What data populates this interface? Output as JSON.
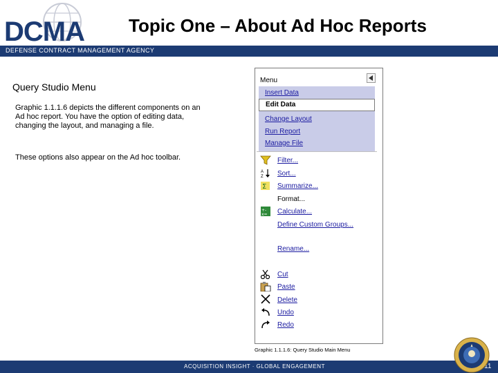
{
  "header": {
    "logo_text": "DCMA",
    "title": "Topic One – About Ad Hoc Reports",
    "agency": "DEFENSE CONTRACT MANAGEMENT AGENCY",
    "brand_color": "#1c3b73"
  },
  "content": {
    "subheading": "Query Studio Menu",
    "description": "Graphic 1.1.1.6 depicts the different components on an Ad hoc report. You have the option of editing data, changing the layout, and managing a file.",
    "note": "These options also appear on the Ad hoc toolbar."
  },
  "menu": {
    "header_label": "Menu",
    "collapse_icon": "triangle-left-icon",
    "main_items": [
      {
        "label": "Insert Data"
      },
      {
        "label": "Edit Data",
        "selected": true
      },
      {
        "label": "Change Layout"
      },
      {
        "label": "Run Report"
      },
      {
        "label": "Manage File"
      }
    ],
    "sub_items": [
      {
        "label": "Filter...",
        "icon": "filter-funnel-icon"
      },
      {
        "label": "Sort...",
        "icon": "sort-az-icon"
      },
      {
        "label": "Summarize...",
        "icon": "summarize-sigma-icon"
      },
      {
        "label": "Format..."
      },
      {
        "label": "Calculate...",
        "icon": "calculator-icon"
      },
      {
        "label": "Define Custom Groups..."
      },
      {
        "label": "Rename..."
      },
      {
        "label": "Cut",
        "icon": "scissors-icon"
      },
      {
        "label": "Paste",
        "icon": "clipboard-icon"
      },
      {
        "label": "Delete",
        "icon": "delete-x-icon"
      },
      {
        "label": "Undo",
        "icon": "undo-arrow-icon"
      },
      {
        "label": "Redo",
        "icon": "redo-arrow-icon"
      }
    ],
    "caption": "Graphic  1.1.1.6: Query Studio Main Menu"
  },
  "footer": {
    "tagline": "ACQUISITION INSIGHT · GLOBAL ENGAGEMENT",
    "page_number": "11",
    "seal_icon": "dod-seal-icon"
  }
}
